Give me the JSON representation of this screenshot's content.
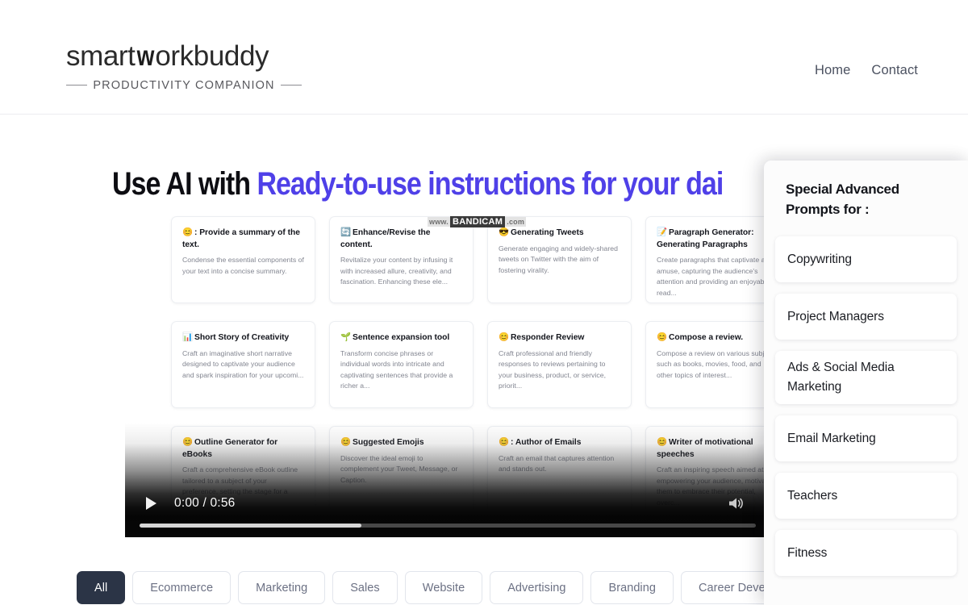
{
  "header": {
    "brand_main": "smart",
    "brand_w": "w",
    "brand_rest": "orkbuddy",
    "brand_tagline": "PRODUCTIVITY COMPANION",
    "nav": [
      {
        "label": "Home"
      },
      {
        "label": "Contact"
      }
    ]
  },
  "hero": {
    "headline_plain": "Use AI with ",
    "headline_accent": "Ready-to-use instructions for your dai",
    "accent_color": "#4f40e8"
  },
  "watermark": {
    "part_a": "www.",
    "part_b": "BANDICAM",
    "part_c": ".com"
  },
  "cards": [
    {
      "emoji": "😊",
      "title": ": Provide a summary of the text.",
      "desc": "Condense the essential components of your text into a concise summary."
    },
    {
      "emoji": "🔄",
      "title": "Enhance/Revise the content.",
      "desc": "Revitalize your content by infusing it with increased allure, creativity, and fascination. Enhancing these ele..."
    },
    {
      "emoji": "😎",
      "title": "Generating Tweets",
      "desc": "Generate engaging and widely-shared tweets on Twitter with the aim of fostering virality."
    },
    {
      "emoji": "📝",
      "title": "Paragraph Generator: Generating Paragraphs",
      "desc": "Create paragraphs that captivate and amuse, capturing the audience's attention and providing an enjoyable read..."
    },
    {
      "emoji": "📊",
      "title": "Short Story of Creativity",
      "desc": "Craft an imaginative short narrative designed to captivate your audience and spark inspiration for your upcomi..."
    },
    {
      "emoji": "🌱",
      "title": "Sentence expansion tool",
      "desc": "Transform concise phrases or individual words into intricate and captivating sentences that provide a richer a..."
    },
    {
      "emoji": "😊",
      "title": "Responder Review",
      "desc": "Craft professional and friendly responses to reviews pertaining to your business, product, or service, priorit..."
    },
    {
      "emoji": "😊",
      "title": "Compose a review.",
      "desc": "Compose a review on various subjects such as books, movies, food, and other topics of interest..."
    },
    {
      "emoji": "😊",
      "title": "Outline Generator for eBooks",
      "desc": "Craft a comprehensive eBook outline tailored to a subject of your preference, setting the stage for a capti..."
    },
    {
      "emoji": "😊",
      "title": "Suggested Emojis",
      "desc": "Discover the ideal emoji to complement your Tweet, Message, or Caption."
    },
    {
      "emoji": "😊",
      "title": ": Author of Emails",
      "desc": "Craft an email that captures attention and stands out."
    },
    {
      "emoji": "😊",
      "title": "Writer of motivational speeches",
      "desc": "Craft an inspiring speech aimed at empowering your audience, motivating them to embrace their potential, overc..."
    }
  ],
  "video": {
    "current_time": "0:00",
    "separator": " / ",
    "duration": "0:56",
    "time_label": "0:00 / 0:56",
    "progress_percent": 36,
    "play_icon": "play-icon",
    "volume_icon": "volume-icon"
  },
  "filters": {
    "active": "All",
    "items": [
      {
        "label": "All",
        "active": true
      },
      {
        "label": "Ecommerce",
        "active": false
      },
      {
        "label": "Marketing",
        "active": false
      },
      {
        "label": "Sales",
        "active": false
      },
      {
        "label": "Website",
        "active": false
      },
      {
        "label": "Advertising",
        "active": false
      },
      {
        "label": "Branding",
        "active": false
      },
      {
        "label": "Career Development",
        "active": false
      }
    ]
  },
  "side_panel": {
    "title": "Special Advanced Prompts for :",
    "items": [
      {
        "label": "Copywriting"
      },
      {
        "label": "Project Managers"
      },
      {
        "label": "Ads & Social Media Marketing"
      },
      {
        "label": "Email Marketing"
      },
      {
        "label": "Teachers"
      },
      {
        "label": "Fitness"
      }
    ]
  }
}
